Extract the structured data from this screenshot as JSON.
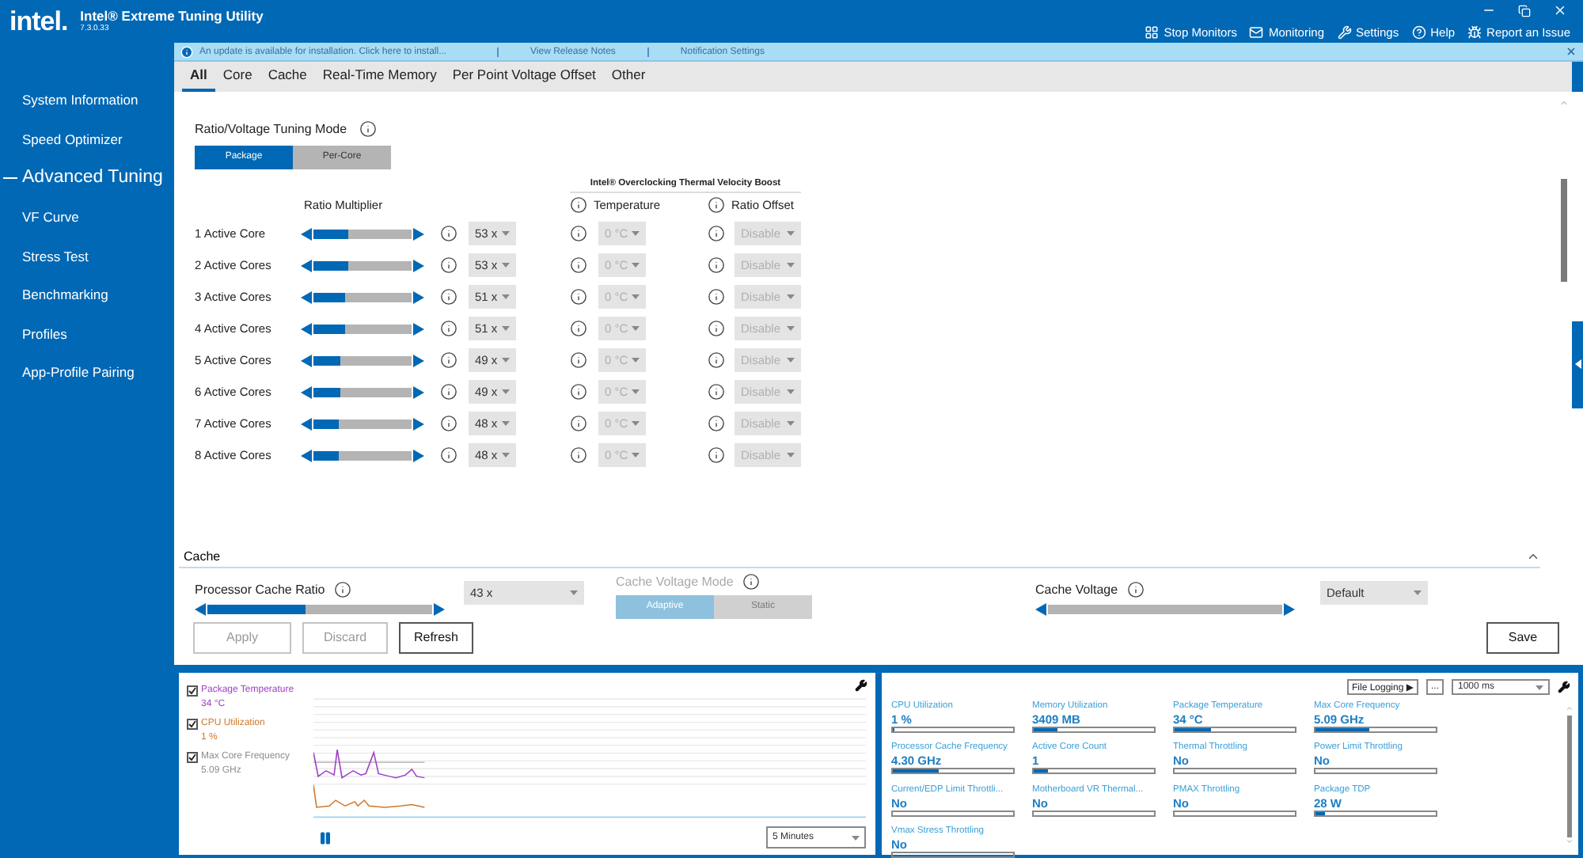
{
  "app": {
    "logo": "intel.",
    "title": "Intel® Extreme Tuning Utility",
    "version": "7.3.0.33"
  },
  "toolbar": [
    {
      "label": "Stop Monitors",
      "kind": "monitors"
    },
    {
      "label": "Monitoring",
      "kind": "monitoring"
    },
    {
      "label": "Settings",
      "kind": "settings"
    },
    {
      "label": "Help",
      "kind": "help"
    },
    {
      "label": "Report an Issue",
      "kind": "report"
    }
  ],
  "sidebar": {
    "items": [
      {
        "label": "System Information",
        "selected": false
      },
      {
        "label": "Speed Optimizer",
        "selected": false
      },
      {
        "label": "Advanced Tuning",
        "selected": true
      },
      {
        "label": "VF Curve",
        "selected": false
      },
      {
        "label": "Stress Test",
        "selected": false
      },
      {
        "label": "Benchmarking",
        "selected": false
      },
      {
        "label": "Profiles",
        "selected": false
      },
      {
        "label": "App-Profile Pairing",
        "selected": false
      }
    ]
  },
  "notification": {
    "message": "An update is available for installation. Click here to install...",
    "links": [
      "View Release Notes",
      "Notification Settings"
    ]
  },
  "tabs": [
    {
      "label": "All",
      "selected": true
    },
    {
      "label": "Core",
      "selected": false
    },
    {
      "label": "Cache",
      "selected": false
    },
    {
      "label": "Real-Time Memory",
      "selected": false
    },
    {
      "label": "Per Point Voltage Offset",
      "selected": false
    },
    {
      "label": "Other",
      "selected": false
    }
  ],
  "tuning_mode": {
    "label": "Ratio/Voltage Tuning Mode",
    "options": [
      {
        "label": "Package",
        "selected": true
      },
      {
        "label": "Per-Core",
        "selected": false
      }
    ]
  },
  "tvb_heading": "Intel® Overclocking Thermal Velocity Boost",
  "columns": {
    "ratio": "Ratio Multiplier",
    "temperature": "Temperature",
    "offset": "Ratio Offset"
  },
  "cores": [
    {
      "label": "1 Active Core",
      "level": 0.36,
      "ratio": "53 x",
      "temperature": "0 °C",
      "temperature_disabled": true,
      "offset": "Disable",
      "offset_disabled": true
    },
    {
      "label": "2 Active Cores",
      "level": 0.36,
      "ratio": "53 x",
      "temperature": "0 °C",
      "temperature_disabled": true,
      "offset": "Disable",
      "offset_disabled": true
    },
    {
      "label": "3 Active Cores",
      "level": 0.32,
      "ratio": "51 x",
      "temperature": "0 °C",
      "temperature_disabled": true,
      "offset": "Disable",
      "offset_disabled": true
    },
    {
      "label": "4 Active Cores",
      "level": 0.32,
      "ratio": "51 x",
      "temperature": "0 °C",
      "temperature_disabled": true,
      "offset": "Disable",
      "offset_disabled": true
    },
    {
      "label": "5 Active Cores",
      "level": 0.28,
      "ratio": "49 x",
      "temperature": "0 °C",
      "temperature_disabled": true,
      "offset": "Disable",
      "offset_disabled": true
    },
    {
      "label": "6 Active Cores",
      "level": 0.28,
      "ratio": "49 x",
      "temperature": "0 °C",
      "temperature_disabled": true,
      "offset": "Disable",
      "offset_disabled": true
    },
    {
      "label": "7 Active Cores",
      "level": 0.26,
      "ratio": "48 x",
      "temperature": "0 °C",
      "temperature_disabled": true,
      "offset": "Disable",
      "offset_disabled": true
    },
    {
      "label": "8 Active Cores",
      "level": 0.26,
      "ratio": "48 x",
      "temperature": "0 °C",
      "temperature_disabled": true,
      "offset": "Disable",
      "offset_disabled": true
    }
  ],
  "cache": {
    "title": "Cache",
    "expanded": true,
    "ratio": {
      "label": "Processor Cache Ratio",
      "level": 0.44,
      "value": "43 x"
    },
    "voltage_mode": {
      "label": "Cache Voltage Mode",
      "disabled": true,
      "options": [
        {
          "label": "Adaptive",
          "selected": true
        },
        {
          "label": "Static",
          "selected": false
        }
      ]
    },
    "voltage": {
      "label": "Cache Voltage",
      "value": "Default"
    }
  },
  "actions": [
    {
      "label": "Apply",
      "disabled": true
    },
    {
      "label": "Discard",
      "disabled": true
    },
    {
      "label": "Refresh",
      "disabled": false
    }
  ],
  "save": {
    "label": "Save",
    "disabled": false
  },
  "graph": {
    "series": [
      {
        "label": "Package Temperature",
        "value": "34 °C",
        "checked": true,
        "color": "#a040c8"
      },
      {
        "label": "CPU Utilization",
        "value": "1 %",
        "checked": true,
        "color": "#d0782a"
      },
      {
        "label": "Max Core Frequency",
        "value": "5.09 GHz",
        "checked": true,
        "color": "#8c8c8c"
      }
    ],
    "range": "5 Minutes"
  },
  "monitor": {
    "logging": "File Logging ▶",
    "more": "...",
    "interval": "1000 ms",
    "metrics": [
      {
        "label": "CPU Utilization",
        "value": "1 %",
        "level": 0.01
      },
      {
        "label": "Memory Utilization",
        "value": "3409  MB",
        "level": 0.2
      },
      {
        "label": "Package Temperature",
        "value": "34 °C",
        "level": 0.3
      },
      {
        "label": "Max Core Frequency",
        "value": "5.09 GHz",
        "level": 0.45
      },
      {
        "label": "Processor Cache Frequency",
        "value": "4.30 GHz",
        "level": 0.38
      },
      {
        "label": "Active Core Count",
        "value": "1",
        "level": 0.12
      },
      {
        "label": "Thermal Throttling",
        "value": "No"
      },
      {
        "label": "Power Limit Throttling",
        "value": "No"
      },
      {
        "label": "Current/EDP Limit Throttli...",
        "value": "No"
      },
      {
        "label": "Motherboard VR Thermal...",
        "value": "No"
      },
      {
        "label": "PMAX Throttling",
        "value": "No"
      },
      {
        "label": "Package TDP",
        "value": "28 W",
        "level": 0.08
      },
      {
        "label": "Vmax Stress Throttling",
        "value": "No"
      }
    ]
  }
}
